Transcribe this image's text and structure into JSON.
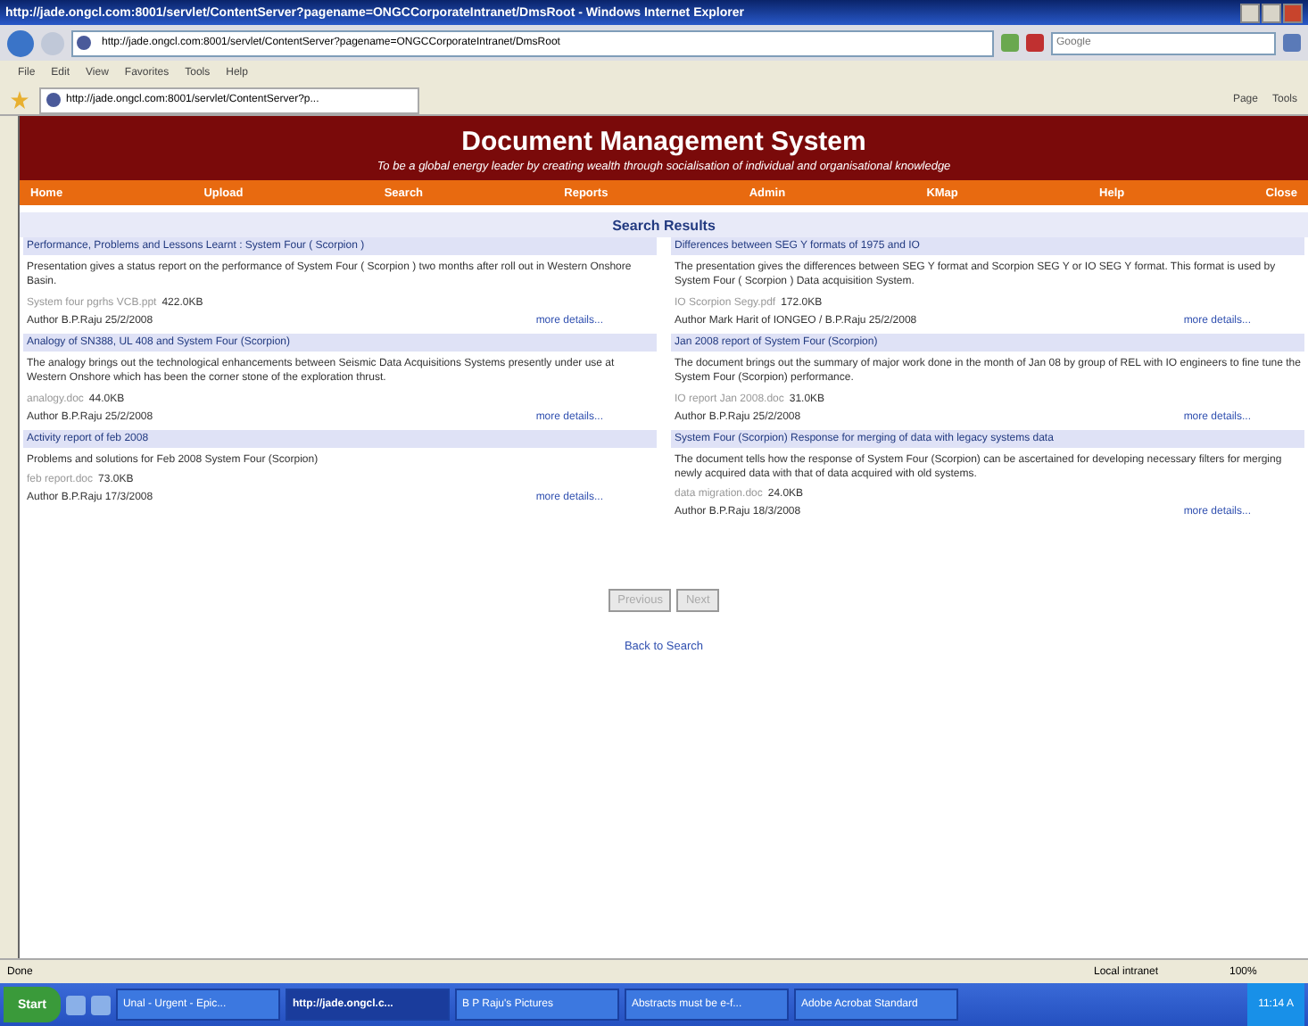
{
  "window": {
    "title": "http://jade.ongcl.com:8001/servlet/ContentServer?pagename=ONGCCorporateIntranet/DmsRoot - Windows Internet Explorer"
  },
  "address_bar": {
    "value": "http://jade.ongcl.com:8001/servlet/ContentServer?pagename=ONGCCorporateIntranet/DmsRoot",
    "search_placeholder": "Google"
  },
  "menu": [
    "File",
    "Edit",
    "View",
    "Favorites",
    "Tools",
    "Help"
  ],
  "tab": {
    "label": "http://jade.ongcl.com:8001/servlet/ContentServer?p..."
  },
  "command_bar": [
    "Page",
    "Tools"
  ],
  "header": {
    "title": "Document Management System",
    "tagline": "To be a global energy leader by creating wealth through socialisation of individual and organisational knowledge"
  },
  "nav": [
    "Home",
    "Upload",
    "Search",
    "Reports",
    "Admin",
    "KMap",
    "Help",
    "Close"
  ],
  "results_heading": "Search Results",
  "columns": [
    [
      {
        "title": "Performance, Problems and Lessons Learnt : System Four ( Scorpion )",
        "description": "Presentation gives a status report on the performance of System Four ( Scorpion ) two months after roll out in Western Onshore Basin.",
        "file": "System four pgrhs VCB.ppt",
        "size": "422.0KB",
        "author": "Author  B.P.Raju  25/2/2008",
        "link": "more details..."
      },
      {
        "title": "Analogy of SN388, UL 408 and System Four (Scorpion)",
        "description": "The analogy brings out the technological enhancements between Seismic Data Acquisitions Systems presently under use at Western Onshore which has been the corner stone of the exploration thrust.",
        "file": "analogy.doc",
        "size": "44.0KB",
        "author": "Author  B.P.Raju  25/2/2008",
        "link": "more details..."
      },
      {
        "title": "Activity report of feb 2008",
        "description": "Problems and solutions for Feb 2008  System Four (Scorpion)",
        "file": "feb report.doc",
        "size": "73.0KB",
        "author": "Author  B.P.Raju  17/3/2008",
        "link": "more details..."
      }
    ],
    [
      {
        "title": "Differences between SEG Y formats of 1975 and IO",
        "description": "The presentation gives the differences between SEG Y format and Scorpion SEG Y or IO SEG Y format. This format is used by System Four ( Scorpion ) Data acquisition System.",
        "file": "IO Scorpion Segy.pdf",
        "size": "172.0KB",
        "author": "Author  Mark Harit of IONGEO / B.P.Raju  25/2/2008",
        "link": "more details..."
      },
      {
        "title": "Jan 2008 report of System Four (Scorpion)",
        "description": "The document brings out the summary of major work done in the month of Jan 08 by group of REL with IO engineers to fine tune the System Four (Scorpion) performance.",
        "file": "IO report Jan 2008.doc",
        "size": "31.0KB",
        "author": "Author  B.P.Raju  25/2/2008",
        "link": "more details..."
      },
      {
        "title": "System Four (Scorpion) Response for merging of data with legacy systems data",
        "description": "The document tells how the response of System Four (Scorpion) can be ascertained for developing necessary filters for merging newly acquired data with that of data acquired with old systems.",
        "file": "data migration.doc",
        "size": "24.0KB",
        "author": "Author  B.P.Raju  18/3/2008",
        "link": "more details..."
      }
    ]
  ],
  "pager": [
    {
      "label": "Previous",
      "disabled": true
    },
    {
      "label": "Next",
      "disabled": true
    }
  ],
  "back_link": "Back to Search",
  "status_bar": {
    "status": "Done",
    "zone": "Local intranet",
    "zoom": "100%"
  },
  "taskbar": {
    "start": "Start",
    "items": [
      {
        "label": "Unal - Urgent - Epic...",
        "selected": false
      },
      {
        "label": "http://jade.ongcl.c...",
        "selected": true
      },
      {
        "label": "B P Raju's Pictures",
        "selected": false
      },
      {
        "label": "Abstracts must be e-f...",
        "selected": false
      },
      {
        "label": "Adobe Acrobat Standard",
        "selected": false
      }
    ],
    "clock": "11:14 A"
  }
}
